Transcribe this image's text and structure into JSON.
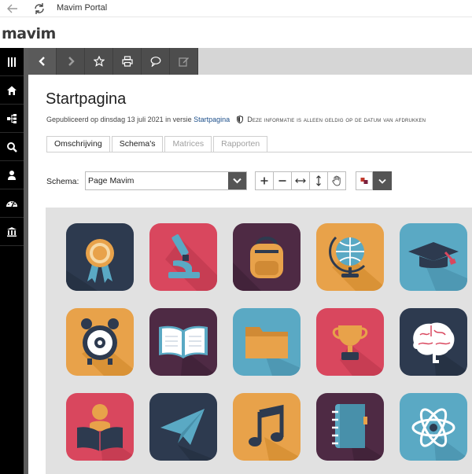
{
  "window": {
    "title": "Mavim Portal"
  },
  "brand": {
    "logo_text": "mavim"
  },
  "left_nav": {
    "items": [
      {
        "icon": "menu-icon"
      },
      {
        "icon": "home-icon"
      },
      {
        "icon": "hierarchy-icon"
      },
      {
        "icon": "search-icon"
      },
      {
        "icon": "user-icon"
      },
      {
        "icon": "dashboard-icon"
      },
      {
        "icon": "institution-icon"
      }
    ]
  },
  "toolbar": {
    "items": [
      {
        "icon": "back-icon",
        "enabled": true
      },
      {
        "icon": "forward-icon",
        "enabled": false
      },
      {
        "icon": "star-icon",
        "enabled": true
      },
      {
        "icon": "print-icon",
        "enabled": true
      },
      {
        "icon": "comment-icon",
        "enabled": true
      },
      {
        "icon": "edit-icon",
        "enabled": false
      }
    ]
  },
  "page": {
    "title": "Startpagina",
    "published_prefix": "Gepubliceerd op dinsdag 13 juli 2021 in versie",
    "version_link": "Startpagina",
    "validity_note": "Deze informatie is alleen geldig op de datum van afdrukken"
  },
  "tabs": [
    {
      "label": "Omschrijving",
      "state": "normal"
    },
    {
      "label": "Schema's",
      "state": "active"
    },
    {
      "label": "Matrices",
      "state": "disabled"
    },
    {
      "label": "Rapporten",
      "state": "disabled"
    }
  ],
  "schema": {
    "label": "Schema:",
    "selected": "Page Mavim"
  },
  "zoom_controls": [
    "zoom-in-icon",
    "zoom-out-icon",
    "fit-width-icon",
    "fit-height-icon",
    "pan-hand-icon"
  ],
  "color_controls": [
    "color-picker-icon",
    "chevron-down-icon"
  ],
  "diagram": {
    "tiles": [
      {
        "icon": "award-ribbon-icon",
        "bg": "#2d3a4f"
      },
      {
        "icon": "microscope-icon",
        "bg": "#d9475e"
      },
      {
        "icon": "backpack-icon",
        "bg": "#4e2a44"
      },
      {
        "icon": "globe-icon",
        "bg": "#e8a24a"
      },
      {
        "icon": "graduation-cap-icon",
        "bg": "#5aa9c4"
      },
      {
        "icon": "alarm-clock-icon",
        "bg": "#e8a24a"
      },
      {
        "icon": "open-book-icon",
        "bg": "#4e2a44"
      },
      {
        "icon": "folder-icon",
        "bg": "#5aa9c4"
      },
      {
        "icon": "trophy-icon",
        "bg": "#d9475e"
      },
      {
        "icon": "brain-icon",
        "bg": "#2d3a4f"
      },
      {
        "icon": "reader-icon",
        "bg": "#d9475e"
      },
      {
        "icon": "paper-plane-icon",
        "bg": "#2d3a4f"
      },
      {
        "icon": "music-note-icon",
        "bg": "#e8a24a"
      },
      {
        "icon": "notebook-icon",
        "bg": "#4e2a44"
      },
      {
        "icon": "atom-icon",
        "bg": "#5aa9c4"
      }
    ]
  }
}
